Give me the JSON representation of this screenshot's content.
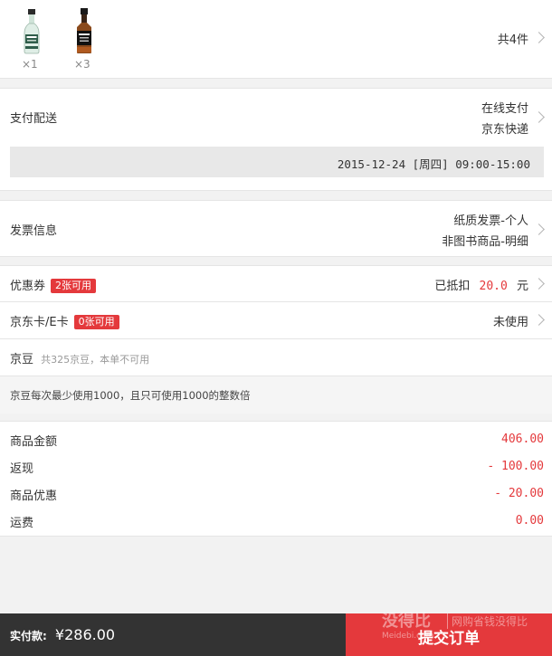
{
  "products": {
    "items": [
      {
        "icon": "gin-bottle-icon",
        "qty": "×1"
      },
      {
        "icon": "whiskey-bottle-icon",
        "qty": "×3"
      }
    ],
    "count_label": "共4件"
  },
  "payment": {
    "label": "支付配送",
    "method": "在线支付",
    "delivery": "京东快递",
    "slot": "2015-12-24 [周四] 09:00-15:00"
  },
  "invoice": {
    "label": "发票信息",
    "type": "纸质发票-个人",
    "content": "非图书商品-明细"
  },
  "coupon": {
    "label": "优惠券",
    "badge": "2张可用",
    "prefix": "已抵扣",
    "amount": "20.0",
    "unit": "元"
  },
  "ecard": {
    "label": "京东卡/E卡",
    "badge": "0张可用",
    "status": "未使用"
  },
  "jingdou": {
    "label": "京豆",
    "note": "共325京豆，本单不可用",
    "rule": "京豆每次最少使用1000，且只可使用1000的整数倍"
  },
  "summary": [
    {
      "label": "商品金额",
      "value": "406.00"
    },
    {
      "label": "返现",
      "value": "- 100.00"
    },
    {
      "label": "商品优惠",
      "value": "- 20.00"
    },
    {
      "label": "运费",
      "value": "0.00"
    }
  ],
  "footer": {
    "pay_label": "实付款:",
    "pay_amount": "¥286.00",
    "submit_label": "提交订单",
    "watermark_cn": "没得比",
    "watermark_en": "Meidebi.com",
    "watermark_slogan": "网购省钱没得比"
  },
  "colors": {
    "accent": "#e4393c",
    "footer_dark": "#333333"
  }
}
